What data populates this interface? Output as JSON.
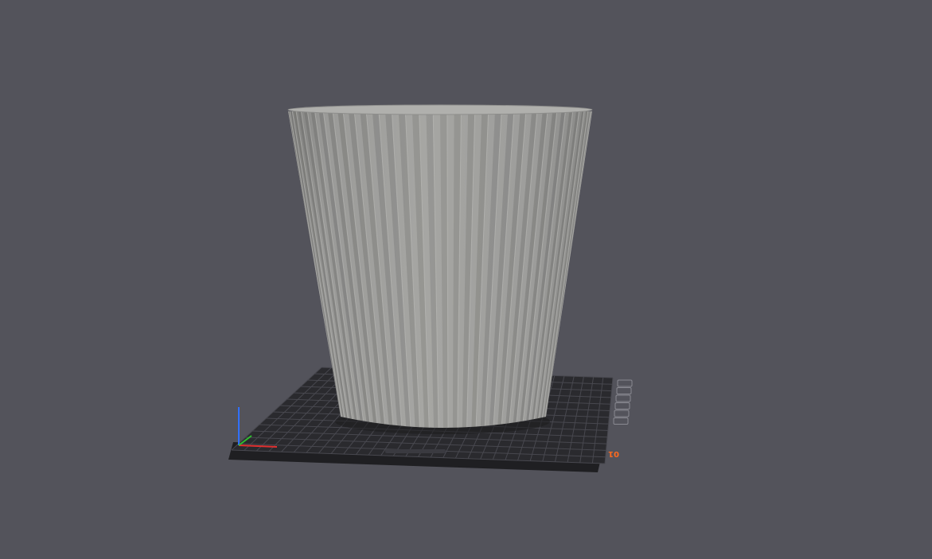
{
  "viewport": {
    "background_color": "#53535b",
    "plate_color": "#2a2a2e",
    "plate_grid_color": "#4a4a52",
    "model_color": "#9c9c9a",
    "plate_number_label": "01",
    "plate_number_color": "#ff6a1e",
    "axis_colors": {
      "x": "#e03030",
      "y": "#2fbf2f",
      "z": "#3070ff"
    }
  },
  "toolbar_icons": [
    "arrange-icon",
    "orient-icon",
    "lock-icon",
    "settings-icon",
    "fill-icon",
    "delete-icon"
  ]
}
